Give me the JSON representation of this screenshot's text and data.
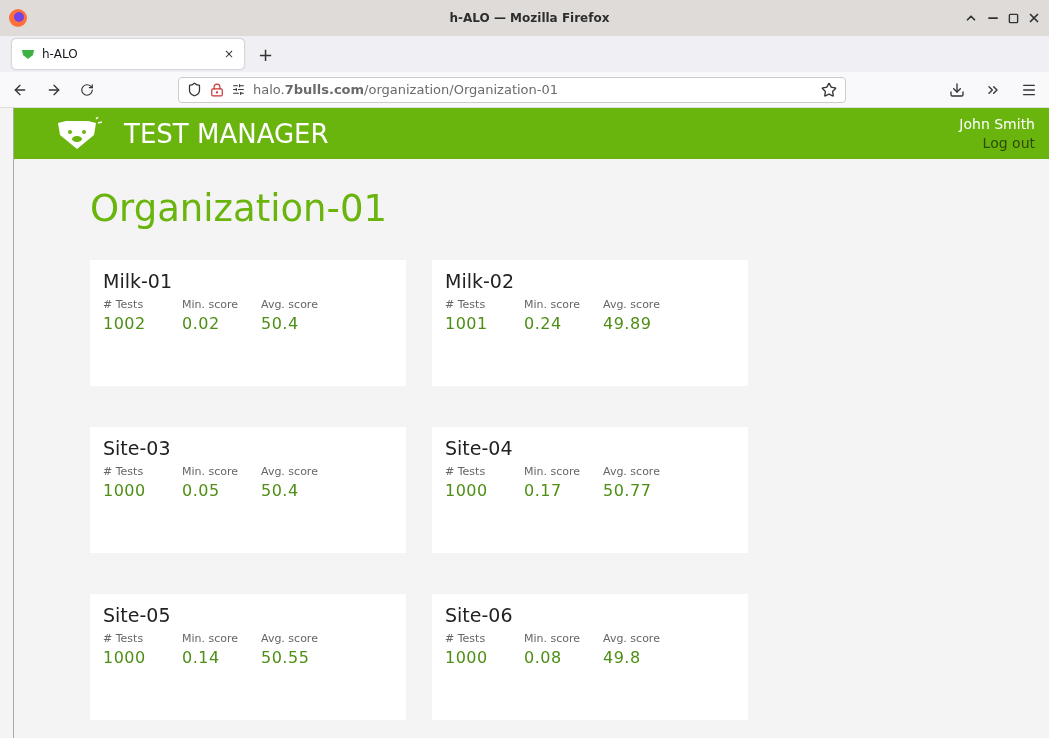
{
  "window": {
    "title": "h-ALO — Mozilla Firefox"
  },
  "tabs": [
    {
      "label": "h-ALO",
      "selected": true,
      "close": "×"
    }
  ],
  "new_tab": "+",
  "address_bar": {
    "url": "halo.**7bulls.com**/organization/Organization-01"
  },
  "header": {
    "app_title": "TEST MANAGER",
    "user": "John Smith",
    "logout": "Log out"
  },
  "page_title": "Organization-01",
  "sites": [
    {
      "name": "Milk-01",
      "labels": [
        "# Tests",
        "Min. score",
        "Avg. score"
      ],
      "values": [
        "1002",
        "0.02",
        "50.4"
      ]
    },
    {
      "name": "Milk-02",
      "labels": [
        "# Tests",
        "Min. score",
        "Avg. score"
      ],
      "values": [
        "1001",
        "0.24",
        "49.89"
      ]
    },
    {
      "name": "Site-03",
      "labels": [
        "# Tests",
        "Min. score",
        "Avg. score"
      ],
      "values": [
        "1000",
        "0.05",
        "50.4"
      ]
    },
    {
      "name": "Site-04",
      "labels": [
        "# Tests",
        "Min. score",
        "Avg. score"
      ],
      "values": [
        "1000",
        "0.17",
        "50.77"
      ]
    },
    {
      "name": "Site-05",
      "labels": [
        "# Tests",
        "Min. score",
        "Avg. score"
      ],
      "values": [
        "1000",
        "0.14",
        "50.55"
      ]
    },
    {
      "name": "Site-06",
      "labels": [
        "# Tests",
        "Min. score",
        "Avg. score"
      ],
      "values": [
        "1000",
        "0.08",
        "49.8"
      ]
    }
  ]
}
